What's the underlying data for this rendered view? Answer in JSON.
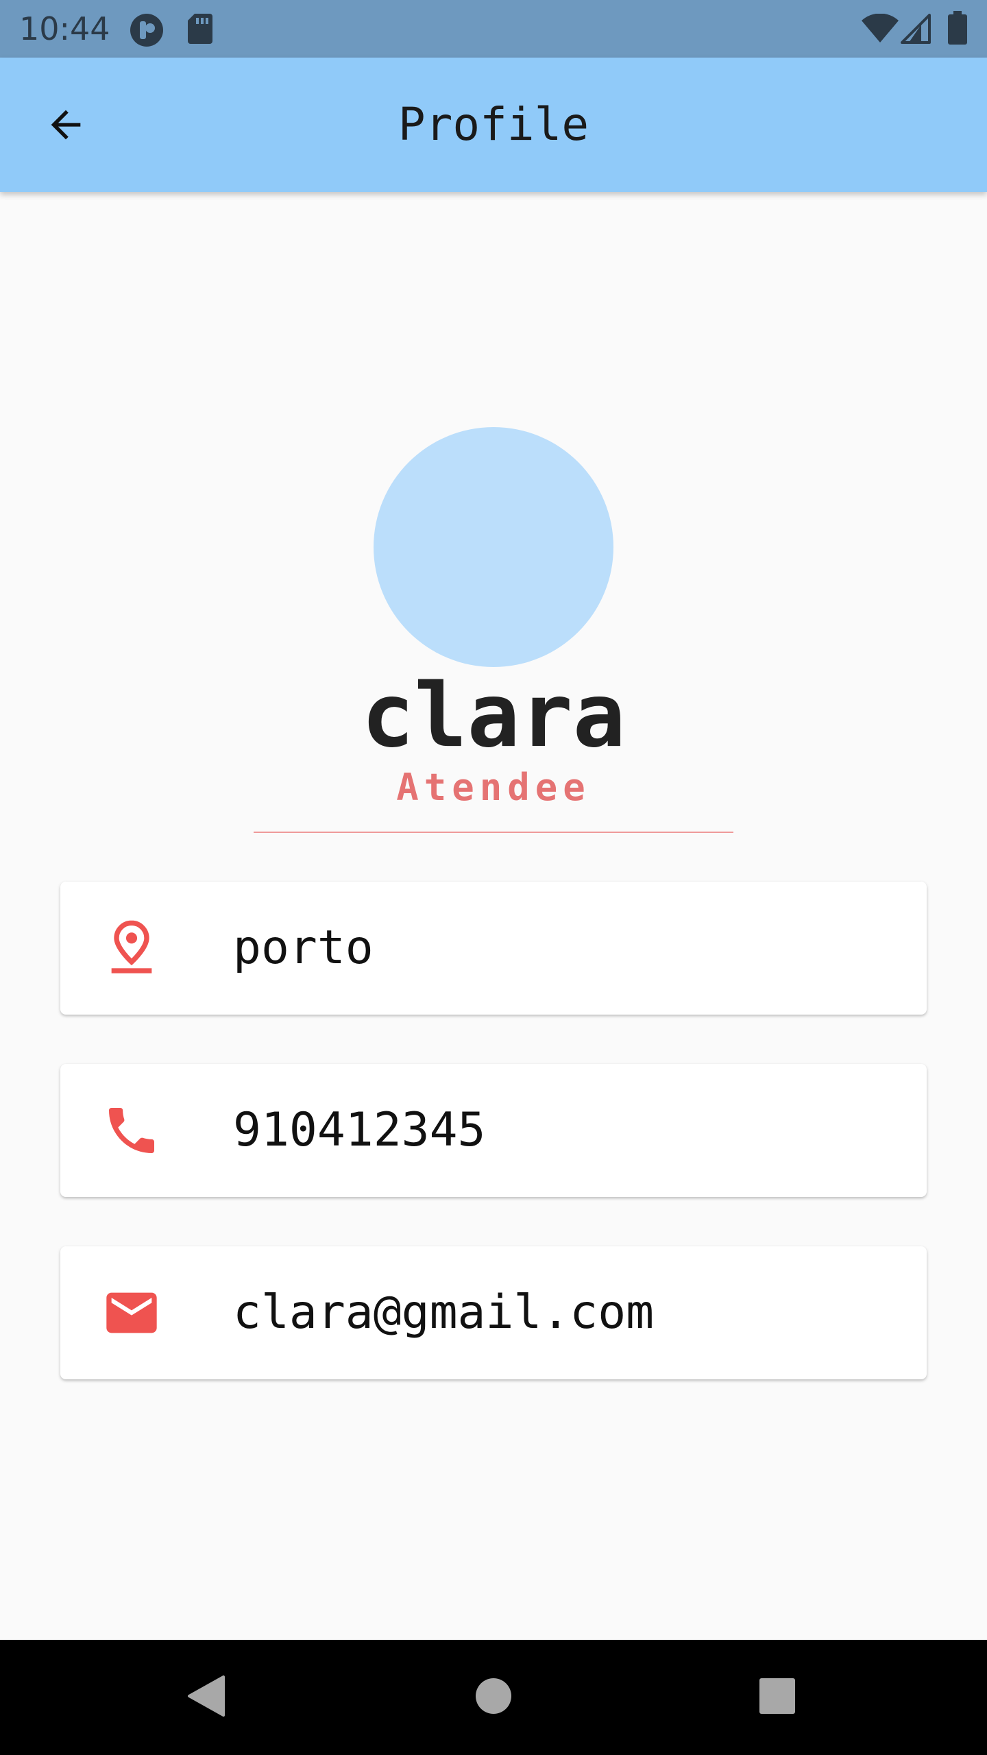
{
  "status_bar": {
    "time": "10:44",
    "left_icons": [
      "notification-app-icon",
      "sd-card-icon"
    ],
    "right_icons": [
      "wifi-icon",
      "cell-signal-icon",
      "battery-icon"
    ]
  },
  "app_bar": {
    "title": "Profile",
    "back_icon": "arrow-back-icon",
    "color": "#90caf9"
  },
  "profile": {
    "name": "clara",
    "role": "Atendee",
    "avatar_color": "#bbdefb",
    "accent_color": "#ef5350"
  },
  "info": {
    "location": {
      "icon": "location-pin-icon",
      "value": "porto"
    },
    "phone": {
      "icon": "phone-icon",
      "value": "910412345"
    },
    "email": {
      "icon": "email-icon",
      "value": "clara@gmail.com"
    }
  },
  "nav_bar": {
    "buttons": [
      "back-triangle-icon",
      "home-circle-icon",
      "recents-square-icon"
    ]
  }
}
